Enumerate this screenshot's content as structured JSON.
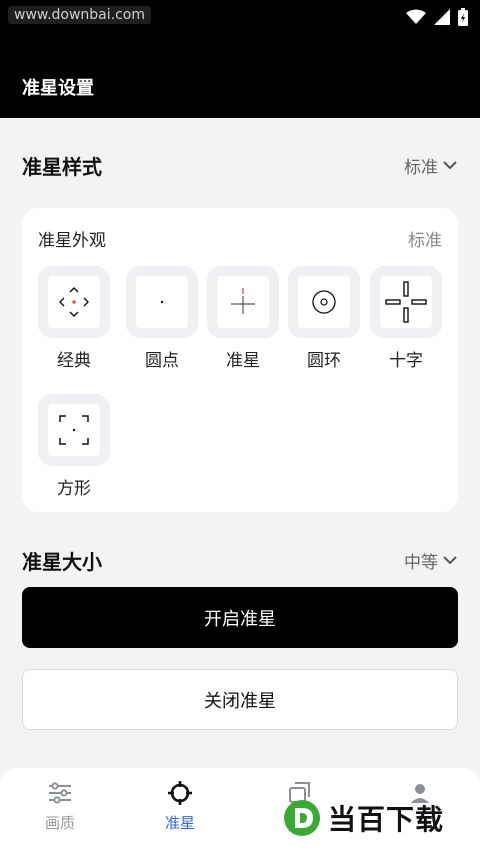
{
  "status_bar": {
    "watermark": "www.downbai.com",
    "icons": [
      "wifi-icon",
      "signal-icon",
      "battery-charging-icon"
    ]
  },
  "app_bar": {
    "title": "准星设置"
  },
  "crosshair_style": {
    "title": "准星样式",
    "value": "标准",
    "card": {
      "title": "准星外观",
      "value": "标准",
      "options": [
        {
          "label": "经典",
          "icon": "classic-crosshair-icon",
          "accent": "#e53935"
        },
        {
          "label": "圆点",
          "icon": "dot-crosshair-icon"
        },
        {
          "label": "准星",
          "icon": "cross-crosshair-icon",
          "accent": "#e53935"
        },
        {
          "label": "圆环",
          "icon": "ring-crosshair-icon"
        },
        {
          "label": "十字",
          "icon": "thick-cross-crosshair-icon"
        },
        {
          "label": "方形",
          "icon": "square-crosshair-icon"
        }
      ]
    }
  },
  "crosshair_size": {
    "title": "准星大小",
    "value": "中等"
  },
  "buttons": {
    "enable": "开启准星",
    "disable": "关闭准星"
  },
  "tabs": [
    {
      "label": "画质",
      "icon": "sliders-icon",
      "active": false
    },
    {
      "label": "准星",
      "icon": "crosshair-icon",
      "active": true
    },
    {
      "label": "",
      "icon": "square-icon",
      "active": false
    },
    {
      "label": "",
      "icon": "user-icon",
      "active": false
    }
  ],
  "brand": {
    "text": "当百下载",
    "logo": "d-logo-icon",
    "logo_color": "#3aaa35"
  },
  "colors": {
    "active_tab": "#2f6bd8",
    "primary_button": "#000000"
  }
}
